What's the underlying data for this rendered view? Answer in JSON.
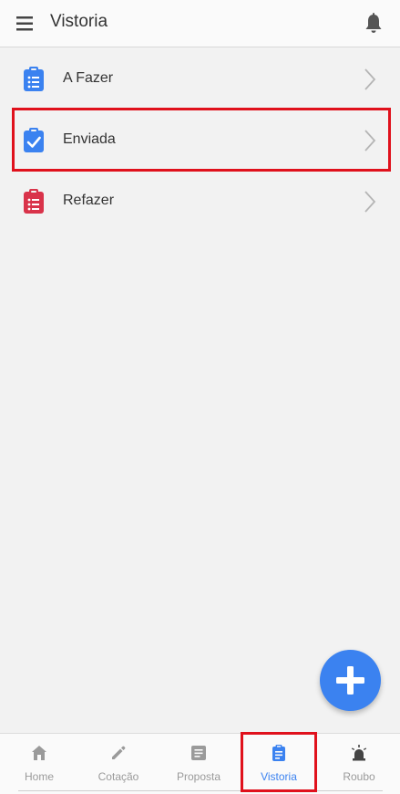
{
  "app_bar": {
    "title": "Vistoria",
    "menu_icon": "hamburger-menu-icon",
    "notification_icon": "bell-icon"
  },
  "list": {
    "items": [
      {
        "label": "A Fazer",
        "icon": "clipboard-list-icon",
        "icon_color": "#3b82f0"
      },
      {
        "label": "Enviada",
        "icon": "clipboard-check-icon",
        "icon_color": "#3b82f0",
        "highlighted": true
      },
      {
        "label": "Refazer",
        "icon": "clipboard-list-icon",
        "icon_color": "#d9334a"
      }
    ]
  },
  "fab": {
    "icon": "plus-icon",
    "color": "#3b82f0"
  },
  "bottom_nav": {
    "items": [
      {
        "label": "Home",
        "icon": "home-icon"
      },
      {
        "label": "Cotação",
        "icon": "pencil-icon"
      },
      {
        "label": "Proposta",
        "icon": "document-icon"
      },
      {
        "label": "Vistoria",
        "icon": "clipboard-icon",
        "active": true
      },
      {
        "label": "Roubo",
        "icon": "siren-icon"
      }
    ],
    "active_color": "#3b82f0",
    "inactive_color": "#9a9a9a"
  },
  "highlight_color": "#e0111c"
}
